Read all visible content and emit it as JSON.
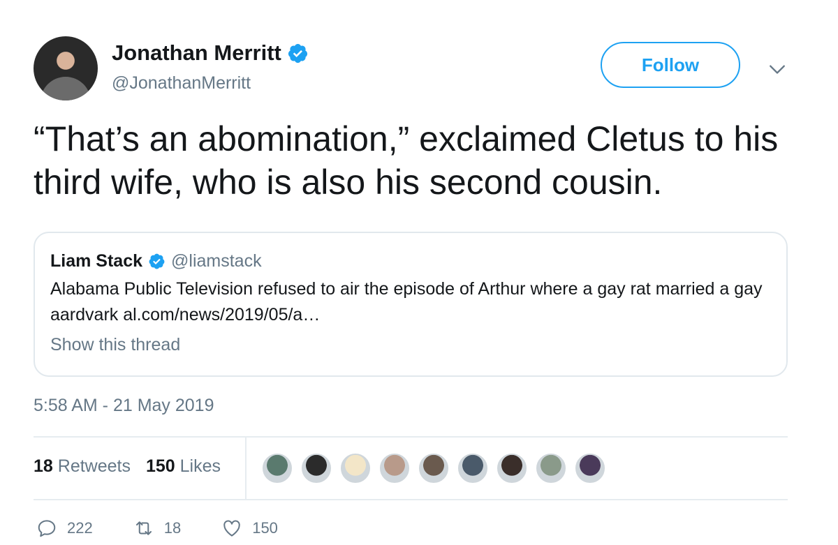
{
  "author": {
    "name": "Jonathan Merritt",
    "handle": "@JonathanMerritt"
  },
  "follow_label": "Follow",
  "tweet_text": "“That’s an abomination,” exclaimed Cletus to his third wife, who is also his second cousin.",
  "quoted": {
    "name": "Liam Stack",
    "handle": "@liamstack",
    "text": "Alabama Public Television refused to air the episode of Arthur where a gay rat married a gay aardvark al.com/news/2019/05/a…",
    "thread_link": "Show this thread"
  },
  "timestamp": "5:58 AM - 21 May 2019",
  "stats": {
    "retweets_count": "18",
    "retweets_label": "Retweets",
    "likes_count": "150",
    "likes_label": "Likes"
  },
  "likers": [
    "#5a7a6e",
    "#2b2b2b",
    "#f3e6c8",
    "#b89a8a",
    "#6a5a4e",
    "#4a5a6a",
    "#3a2e2a",
    "#8a9a8a",
    "#4a3a5a"
  ],
  "actions": {
    "replies": "222",
    "retweets": "18",
    "likes": "150"
  },
  "colors": {
    "accent": "#1da1f2",
    "secondary_text": "#657786",
    "primary_text": "#14171a"
  },
  "icons": [
    "verified-badge-icon",
    "chevron-down-icon",
    "reply-icon",
    "retweet-icon",
    "heart-icon"
  ]
}
